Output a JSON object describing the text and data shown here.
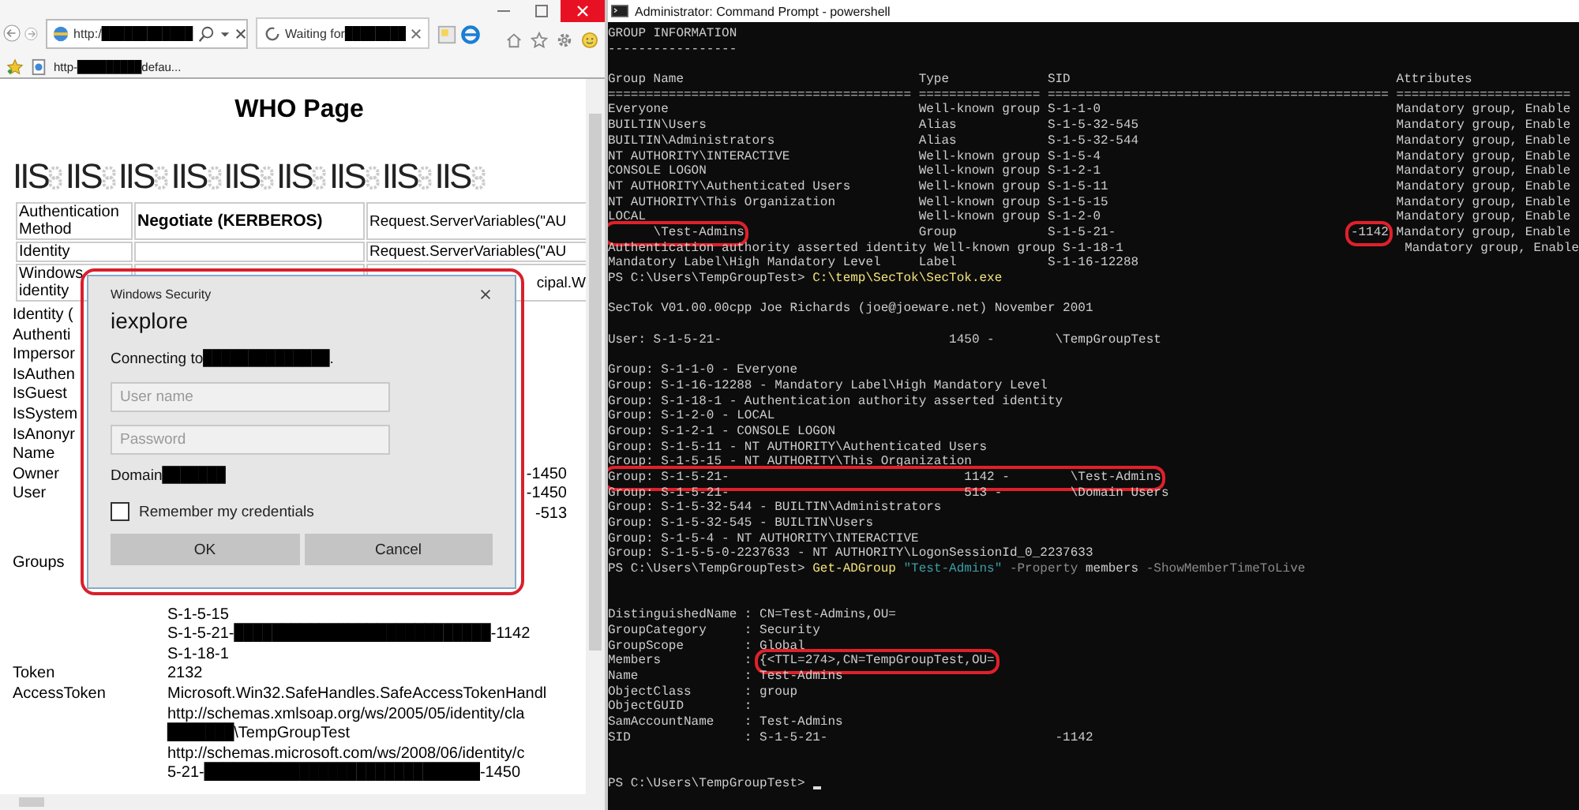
{
  "browser": {
    "address": {
      "text": "http:/",
      "redacted": "████████████"
    },
    "tab": {
      "label": "Waiting for",
      "redacted": "████████"
    },
    "favorite": {
      "before": "http-",
      "redacted": "█████████",
      "after": "defau..."
    },
    "page_title": "WHO Page",
    "banner": [
      "IIS",
      "IIS",
      "IIS",
      "IIS",
      "IIS",
      "IIS",
      "IIS",
      "IIS",
      "IIS"
    ],
    "info_table": [
      {
        "label": "Authentication Method",
        "value": "Negotiate (KERBEROS)",
        "source": [
          "Request.ServerVariables(\"AU"
        ]
      },
      {
        "label": "Identity",
        "source": [
          "Request.ServerVariables(\"AU"
        ]
      },
      {
        "label": "Windows identity",
        "source": [
          "cipal.W"
        ]
      }
    ],
    "details": [
      {
        "label": "Identity ("
      },
      {
        "label": "Authenti"
      },
      {
        "label": "Impersor"
      },
      {
        "label": "IsAuthen"
      },
      {
        "label": "IsGuest"
      },
      {
        "label": "IsSystem"
      },
      {
        "label": "IsAnonyr"
      },
      {
        "label": "Name"
      },
      {
        "label": "Owner",
        "lines": [
          {
            "before": "-1450"
          }
        ]
      },
      {
        "label": "User",
        "lines": [
          {
            "before": "-1450"
          },
          {
            "before": "-513"
          }
        ]
      },
      {
        "label": "Groups",
        "lines": [
          {
            "before": "S-1-5-15"
          },
          {
            "before": "S-1-5-21-",
            "redacted": "███████████████████████████",
            "after": "-1142"
          },
          {
            "before": "S-1-18-1"
          }
        ]
      },
      {
        "label": "Token",
        "lines": [
          {
            "before": "2132"
          }
        ]
      },
      {
        "label": "AccessToken",
        "lines": [
          {
            "before": "Microsoft.Win32.SafeHandles.SafeAccessTokenHandl"
          },
          {
            "before": "http://schemas.xmlsoap.org/ws/2005/05/identity/cla"
          },
          {
            "redacted": "███████",
            "after": "\\TempGroupTest"
          },
          {
            "before": "http://schemas.microsoft.com/ws/2008/06/identity/c"
          },
          {
            "before": "5-21-",
            "redacted": "█████████████████████████████",
            "after": "-1450"
          }
        ]
      }
    ],
    "dialog": {
      "highlighted": true,
      "title": "Windows Security",
      "app": "iexplore",
      "message": "Connecting to",
      "message_redacted": "██████████████",
      "message_end": ".",
      "fields": [
        {
          "placeholder": "User name"
        },
        {
          "placeholder": "Password"
        }
      ],
      "domain_label": "Domain",
      "domain_redacted": "███████",
      "remember": {
        "label": "Remember my credentials",
        "checked": false
      },
      "buttons": [
        "OK",
        "Cancel"
      ]
    }
  },
  "console": {
    "title": "Administrator: Command Prompt - powershell",
    "lines": [
      {
        "kind": "text",
        "parts": [
          {
            "kind": "plain",
            "text": "GROUP INFORMATION"
          }
        ]
      },
      {
        "kind": "text",
        "parts": [
          {
            "kind": "plain",
            "text": "-----------------"
          }
        ]
      },
      {
        "kind": "blank"
      },
      {
        "kind": "group_row",
        "name": "Group Name",
        "type": "Type",
        "sid": "SID",
        "attributes": "Attributes"
      },
      {
        "kind": "group_row",
        "name": "========================================",
        "type": "================",
        "sid": "=============================================",
        "attributes": "======================="
      },
      {
        "kind": "group_row",
        "name": "Everyone",
        "type": "Well-known group",
        "sid": "S-1-1-0",
        "attributes": "Mandatory group, Enable"
      },
      {
        "kind": "group_row",
        "name": "BUILTIN\\Users",
        "type": "Alias",
        "sid": "S-1-5-32-545",
        "attributes": "Mandatory group, Enable"
      },
      {
        "kind": "group_row",
        "name": "BUILTIN\\Administrators",
        "type": "Alias",
        "sid": "S-1-5-32-544",
        "attributes": "Mandatory group, Enable"
      },
      {
        "kind": "group_row",
        "name": "NT AUTHORITY\\INTERACTIVE",
        "type": "Well-known group",
        "sid": "S-1-5-4",
        "attributes": "Mandatory group, Enable"
      },
      {
        "kind": "group_row",
        "name": "CONSOLE LOGON",
        "type": "Well-known group",
        "sid": "S-1-2-1",
        "attributes": "Mandatory group, Enable"
      },
      {
        "kind": "group_row",
        "name": "NT AUTHORITY\\Authenticated Users",
        "type": "Well-known group",
        "sid": "S-1-5-11",
        "attributes": "Mandatory group, Enable"
      },
      {
        "kind": "group_row",
        "name": "NT AUTHORITY\\This Organization",
        "type": "Well-known group",
        "sid": "S-1-5-15",
        "attributes": "Mandatory group, Enable"
      },
      {
        "kind": "group_row",
        "name": "LOCAL",
        "type": "Well-known group",
        "sid": "S-1-2-0",
        "attributes": "Mandatory group, Enable"
      },
      {
        "kind": "group_row",
        "name": "      \\Test-Admins",
        "name_marked": true,
        "type": "Group",
        "sid": "S-1-5-21-",
        "sid_tail": "-1142",
        "sid_tail_marked": true,
        "attributes": "Mandatory group, Enable"
      },
      {
        "kind": "group_row",
        "name": "Authentication authority asserted identity",
        "type": "Well-known group",
        "sid": "S-1-18-1",
        "attributes": "Mandatory group, Enable"
      },
      {
        "kind": "group_row",
        "name": "Mandatory Label\\High Mandatory Level",
        "type": "Label",
        "sid": "S-1-16-12288"
      },
      {
        "kind": "text",
        "parts": [
          {
            "kind": "prompt",
            "text": "PS C:\\Users\\TempGroupTest> "
          },
          {
            "kind": "command",
            "text": "C:\\temp\\SecTok\\SecTok.exe"
          }
        ]
      },
      {
        "kind": "blank"
      },
      {
        "kind": "text",
        "parts": [
          {
            "kind": "plain",
            "text": "SecTok V01.00.00cpp Joe Richards (joe@joeware.net) November 2001"
          }
        ]
      },
      {
        "kind": "blank"
      },
      {
        "kind": "text",
        "parts": [
          {
            "kind": "plain",
            "text": "User: S-1-5-21-                              1450 -        \\TempGroupTest"
          }
        ]
      },
      {
        "kind": "blank"
      },
      {
        "kind": "text",
        "parts": [
          {
            "kind": "plain",
            "text": "Group: S-1-1-0 - Everyone"
          }
        ]
      },
      {
        "kind": "text",
        "parts": [
          {
            "kind": "plain",
            "text": "Group: S-1-16-12288 - Mandatory Label\\High Mandatory Level"
          }
        ]
      },
      {
        "kind": "text",
        "parts": [
          {
            "kind": "plain",
            "text": "Group: S-1-18-1 - Authentication authority asserted identity"
          }
        ]
      },
      {
        "kind": "text",
        "parts": [
          {
            "kind": "plain",
            "text": "Group: S-1-2-0 - LOCAL"
          }
        ]
      },
      {
        "kind": "text",
        "parts": [
          {
            "kind": "plain",
            "text": "Group: S-1-2-1 - CONSOLE LOGON"
          }
        ]
      },
      {
        "kind": "text",
        "parts": [
          {
            "kind": "plain",
            "text": "Group: S-1-5-11 - NT AUTHORITY\\Authenticated Users"
          }
        ]
      },
      {
        "kind": "text",
        "parts": [
          {
            "kind": "plain",
            "text": "Group: S-1-5-15 - NT AUTHORITY\\This Organization"
          }
        ]
      },
      {
        "kind": "text",
        "parts": [
          {
            "kind": "plain",
            "marked": true,
            "text": "Group: S-1-5-21-                               1142 -        \\Test-Admins"
          }
        ]
      },
      {
        "kind": "text",
        "parts": [
          {
            "kind": "plain",
            "text": "Group: S-1-5-21-                               513 -         \\Domain Users"
          }
        ]
      },
      {
        "kind": "text",
        "parts": [
          {
            "kind": "plain",
            "text": "Group: S-1-5-32-544 - BUILTIN\\Administrators"
          }
        ]
      },
      {
        "kind": "text",
        "parts": [
          {
            "kind": "plain",
            "text": "Group: S-1-5-32-545 - BUILTIN\\Users"
          }
        ]
      },
      {
        "kind": "text",
        "parts": [
          {
            "kind": "plain",
            "text": "Group: S-1-5-4 - NT AUTHORITY\\INTERACTIVE"
          }
        ]
      },
      {
        "kind": "text",
        "parts": [
          {
            "kind": "plain",
            "text": "Group: S-1-5-5-0-2237633 - NT AUTHORITY\\LogonSessionId_0_2237633"
          }
        ]
      },
      {
        "kind": "text",
        "parts": [
          {
            "kind": "prompt",
            "text": "PS C:\\Users\\TempGroupTest> "
          },
          {
            "kind": "command",
            "text": "Get-ADGroup"
          },
          {
            "kind": "string",
            "text": " \"Test-Admins\""
          },
          {
            "kind": "parameter",
            "text": " -Property"
          },
          {
            "kind": "plain",
            "text": " members"
          },
          {
            "kind": "parameter",
            "text": " -ShowMemberTimeToLive"
          }
        ]
      },
      {
        "kind": "blank"
      },
      {
        "kind": "blank"
      },
      {
        "kind": "text",
        "parts": [
          {
            "kind": "plain",
            "text": "DistinguishedName : CN=Test-Admins,OU="
          }
        ]
      },
      {
        "kind": "text",
        "parts": [
          {
            "kind": "plain",
            "text": "GroupCategory     : Security"
          }
        ]
      },
      {
        "kind": "text",
        "parts": [
          {
            "kind": "plain",
            "text": "GroupScope        : Global"
          }
        ]
      },
      {
        "kind": "text",
        "parts": [
          {
            "kind": "plain",
            "text": "Members           : "
          },
          {
            "kind": "plain",
            "marked": true,
            "text": "{<TTL=274>,CN=TempGroupTest,OU="
          }
        ]
      },
      {
        "kind": "text",
        "parts": [
          {
            "kind": "plain",
            "text": "Name              : Test-Admins"
          }
        ]
      },
      {
        "kind": "text",
        "parts": [
          {
            "kind": "plain",
            "text": "ObjectClass       : group"
          }
        ]
      },
      {
        "kind": "text",
        "parts": [
          {
            "kind": "plain",
            "text": "ObjectGUID        :"
          }
        ]
      },
      {
        "kind": "text",
        "parts": [
          {
            "kind": "plain",
            "text": "SamAccountName    : Test-Admins"
          }
        ]
      },
      {
        "kind": "text",
        "parts": [
          {
            "kind": "plain",
            "text": "SID               : S-1-5-21-                              -1142"
          }
        ]
      },
      {
        "kind": "blank"
      },
      {
        "kind": "blank"
      },
      {
        "kind": "text",
        "cursor": true,
        "parts": [
          {
            "kind": "prompt",
            "text": "PS C:\\Users\\TempGroupTest> "
          }
        ]
      }
    ]
  }
}
